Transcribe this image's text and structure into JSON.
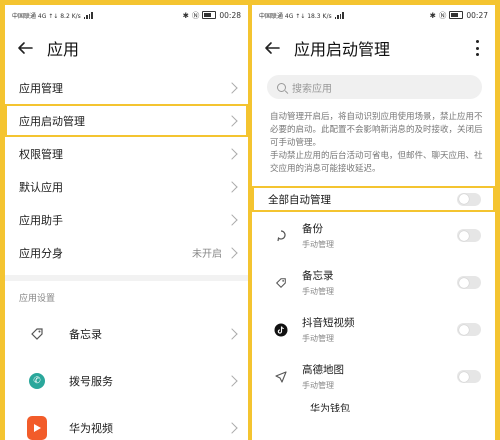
{
  "left": {
    "status": {
      "left": "中国联通 4G ↑↓ 8.2 K/s",
      "right": "00:28"
    },
    "title": "应用",
    "menu": [
      {
        "label": "应用管理",
        "value": ""
      },
      {
        "label": "应用启动管理",
        "value": ""
      },
      {
        "label": "权限管理",
        "value": ""
      },
      {
        "label": "默认应用",
        "value": ""
      },
      {
        "label": "应用助手",
        "value": ""
      },
      {
        "label": "应用分身",
        "value": "未开启"
      }
    ],
    "section_title": "应用设置",
    "apps": [
      {
        "label": "备忘录",
        "icon": "tag-icon"
      },
      {
        "label": "拨号服务",
        "icon": "phone-icon"
      },
      {
        "label": "华为视频",
        "icon": "play-icon"
      }
    ]
  },
  "right": {
    "status": {
      "left": "中国联通 4G ↑↓ 18.3 K/s",
      "right": "00:27"
    },
    "title": "应用启动管理",
    "search_placeholder": "搜索应用",
    "desc1": "自动管理开启后，将自动识别应用使用场景，禁止应用不必要的启动。此配置不会影响新消息的及时接收，关闭后可手动管理。",
    "desc2": "手动禁止应用的后台活动可省电，但邮件、聊天应用、社交应用的消息可能接收延迟。",
    "toggle_all_label": "全部自动管理",
    "apps": [
      {
        "name": "备份",
        "sub": "手动管理",
        "icon": "backup-icon"
      },
      {
        "name": "备忘录",
        "sub": "手动管理",
        "icon": "tag-icon"
      },
      {
        "name": "抖音短视频",
        "sub": "手动管理",
        "icon": "douyin-icon"
      },
      {
        "name": "高德地图",
        "sub": "手动管理",
        "icon": "navigation-icon"
      }
    ],
    "cut_label": "华为钱包"
  },
  "colors": {
    "highlight": "#f4c430",
    "background": "#f4c430"
  }
}
